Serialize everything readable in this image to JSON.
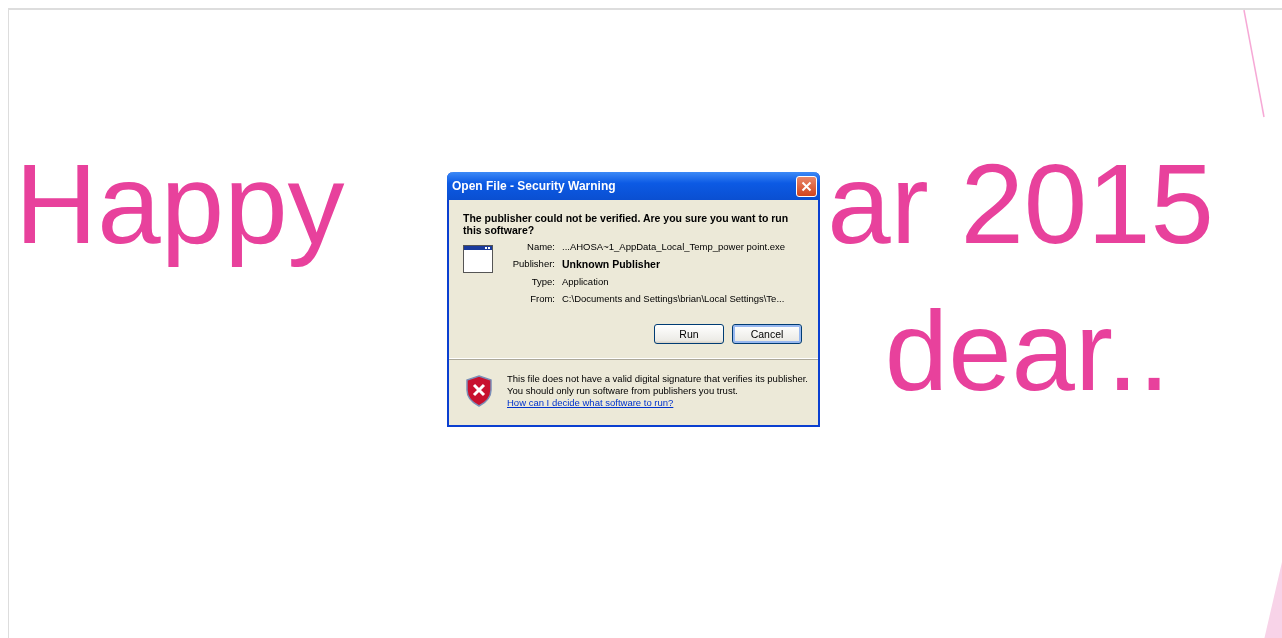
{
  "slide": {
    "title_parts": [
      "Happy",
      "ar 2015"
    ],
    "subtitle": "dear.."
  },
  "dialog": {
    "title": "Open File - Security Warning",
    "question": "The publisher could not be verified.  Are you sure you want to run this software?",
    "fields": [
      {
        "label": "Name:",
        "value": "...AHOSA~1_AppData_Local_Temp_power point.exe",
        "bold": false
      },
      {
        "label": "Publisher:",
        "value": "Unknown Publisher",
        "bold": true
      },
      {
        "label": "Type:",
        "value": "Application",
        "bold": false
      },
      {
        "label": "From:",
        "value": "C:\\Documents and Settings\\brian\\Local Settings\\Te...",
        "bold": false
      }
    ],
    "buttons": [
      {
        "label": "Run",
        "focused": false
      },
      {
        "label": "Cancel",
        "focused": true
      }
    ],
    "warning": "This file does not have a valid digital signature that verifies its publisher.  You should only run software from publishers you trust.",
    "link": "How can I decide what software to run?"
  }
}
